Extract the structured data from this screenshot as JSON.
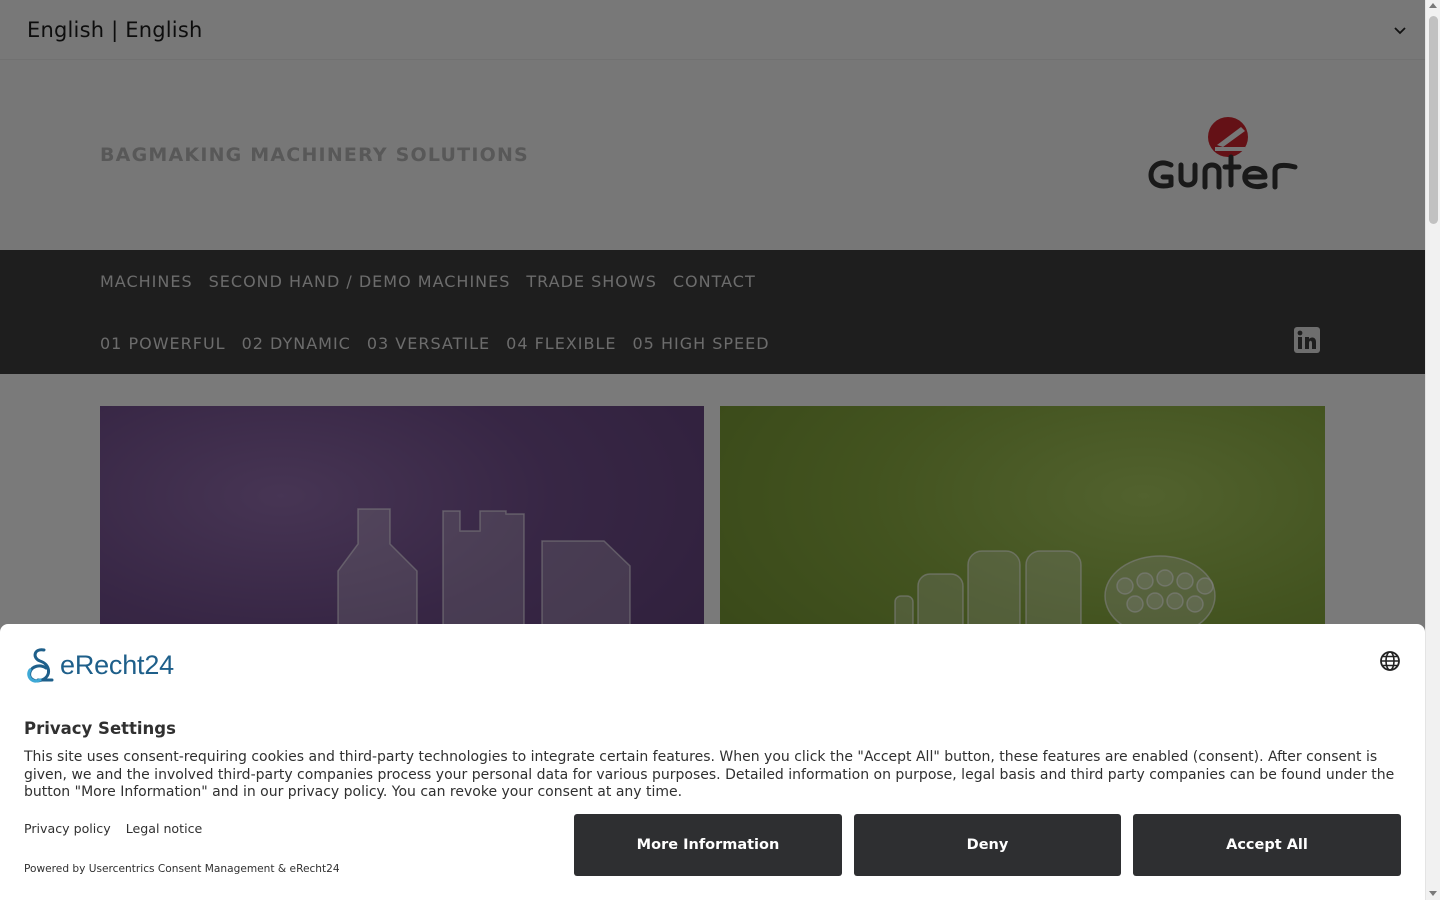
{
  "language_bar": {
    "current": "English | English"
  },
  "header": {
    "tagline": "BAGMAKING MACHINERY SOLUTIONS",
    "logo_text": "Günter"
  },
  "nav": {
    "primary": [
      "MACHINES",
      "SECOND HAND / DEMO MACHINES",
      "TRADE SHOWS",
      "CONTACT"
    ],
    "secondary": [
      "01 POWERFUL",
      "02 DYNAMIC",
      "03 VERSATILE",
      "04 FLEXIBLE",
      "05 HIGH SPEED"
    ],
    "social_icon": "linkedin-icon"
  },
  "tiles": [
    {
      "name": "purple-bag-tile",
      "color": "#6f4d8a"
    },
    {
      "name": "green-rolls-tile",
      "color": "#86a73f"
    }
  ],
  "consent": {
    "brand": "eRecht24",
    "title": "Privacy Settings",
    "description": "This site uses consent-requiring cookies and third-party technologies to integrate certain features. When you click the \"Accept All\" button, these features are enabled (consent). After consent is given, we and the involved third-party companies process your personal data for various purposes. Detailed information on purpose, legal basis and third party companies can be found under the button \"More Information\" and in our privacy policy. You can revoke your consent at any time.",
    "links": {
      "privacy_policy": "Privacy policy",
      "legal_notice": "Legal notice"
    },
    "powered_by": "Powered by Usercentrics Consent Management & eRecht24",
    "buttons": {
      "more_info": "More Information",
      "deny": "Deny",
      "accept_all": "Accept All"
    }
  },
  "colors": {
    "nav_bg": "#3c3c3c",
    "button_bg": "#2e2f31",
    "brand_blue": "#1e5f8a",
    "logo_red": "#c8232c"
  }
}
